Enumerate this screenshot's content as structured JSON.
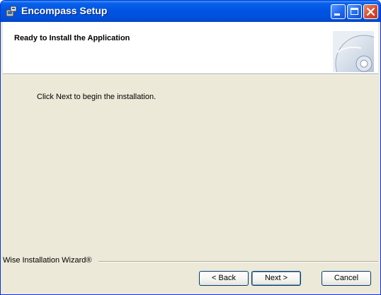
{
  "window": {
    "title": "Encompass Setup"
  },
  "header": {
    "title": "Ready to Install the Application"
  },
  "body": {
    "instruction": "Click Next to begin the installation."
  },
  "branding": {
    "text": "Wise Installation Wizard®"
  },
  "buttons": {
    "back_label": "< Back",
    "next_label": "Next >",
    "cancel_label": "Cancel"
  },
  "colors": {
    "titlebar": "#0054e3",
    "dialog_bg": "#ece9d8",
    "close_button": "#d5482b"
  }
}
